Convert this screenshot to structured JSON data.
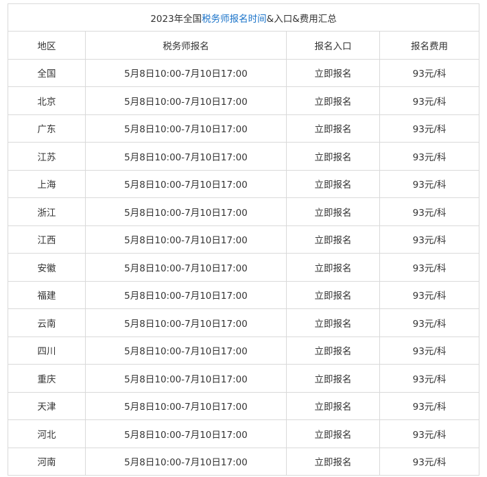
{
  "title": {
    "prefix": "2023年全国",
    "highlight": "税务师报名时间",
    "suffix": "&入口&费用汇总"
  },
  "headers": [
    "地区",
    "税务师报名",
    "报名入口",
    "报名费用"
  ],
  "rows": [
    [
      "全国",
      "5月8日10:00-7月10日17:00",
      "立即报名",
      "93元/科"
    ],
    [
      "北京",
      "5月8日10:00-7月10日17:00",
      "立即报名",
      "93元/科"
    ],
    [
      "广东",
      "5月8日10:00-7月10日17:00",
      "立即报名",
      "93元/科"
    ],
    [
      "江苏",
      "5月8日10:00-7月10日17:00",
      "立即报名",
      "93元/科"
    ],
    [
      "上海",
      "5月8日10:00-7月10日17:00",
      "立即报名",
      "93元/科"
    ],
    [
      "浙江",
      "5月8日10:00-7月10日17:00",
      "立即报名",
      "93元/科"
    ],
    [
      "江西",
      "5月8日10:00-7月10日17:00",
      "立即报名",
      "93元/科"
    ],
    [
      "安徽",
      "5月8日10:00-7月10日17:00",
      "立即报名",
      "93元/科"
    ],
    [
      "福建",
      "5月8日10:00-7月10日17:00",
      "立即报名",
      "93元/科"
    ],
    [
      "云南",
      "5月8日10:00-7月10日17:00",
      "立即报名",
      "93元/科"
    ],
    [
      "四川",
      "5月8日10:00-7月10日17:00",
      "立即报名",
      "93元/科"
    ],
    [
      "重庆",
      "5月8日10:00-7月10日17:00",
      "立即报名",
      "93元/科"
    ],
    [
      "天津",
      "5月8日10:00-7月10日17:00",
      "立即报名",
      "93元/科"
    ],
    [
      "河北",
      "5月8日10:00-7月10日17:00",
      "立即报名",
      "93元/科"
    ],
    [
      "河南",
      "5月8日10:00-7月10日17:00",
      "立即报名",
      "93元/科"
    ]
  ],
  "colors": {
    "highlight": "#1a73c9",
    "border": "#d9d9d9",
    "text": "#333333"
  }
}
